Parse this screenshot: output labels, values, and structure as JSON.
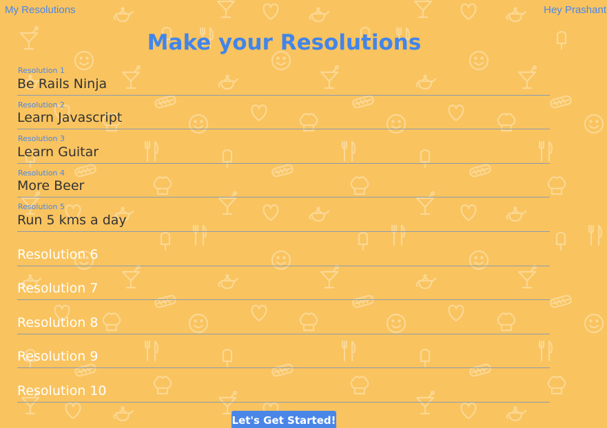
{
  "nav": {
    "brand": "My Resolutions",
    "greeting": "Hey Prashant"
  },
  "page": {
    "title": "Make your Resolutions"
  },
  "resolutions": [
    {
      "label": "Resolution 1",
      "value": "Be Rails Ninja",
      "placeholder": "Resolution 1"
    },
    {
      "label": "Resolution 2",
      "value": "Learn Javascript",
      "placeholder": "Resolution 2"
    },
    {
      "label": "Resolution 3",
      "value": "Learn Guitar",
      "placeholder": "Resolution 3"
    },
    {
      "label": "Resolution 4",
      "value": "More Beer",
      "placeholder": "Resolution 4"
    },
    {
      "label": "Resolution 5",
      "value": "Run 5 kms a day",
      "placeholder": "Resolution 5"
    },
    {
      "label": "",
      "value": "",
      "placeholder": "Resolution 6"
    },
    {
      "label": "",
      "value": "",
      "placeholder": "Resolution 7"
    },
    {
      "label": "",
      "value": "",
      "placeholder": "Resolution 8"
    },
    {
      "label": "",
      "value": "",
      "placeholder": "Resolution 9"
    },
    {
      "label": "",
      "value": "",
      "placeholder": "Resolution 10"
    }
  ],
  "actions": {
    "submit_label": "Let's Get Started!"
  },
  "background": {
    "pattern_icons": [
      "teapot-icon",
      "heart-icon",
      "smiley-icon",
      "cocktail-icon",
      "popsicle-icon",
      "hotdog-icon",
      "chef-hat-icon",
      "fork-knife-icon"
    ]
  },
  "colors": {
    "background": "#f9c35f",
    "accent": "#4a86e8",
    "pattern": "#fbd894"
  }
}
